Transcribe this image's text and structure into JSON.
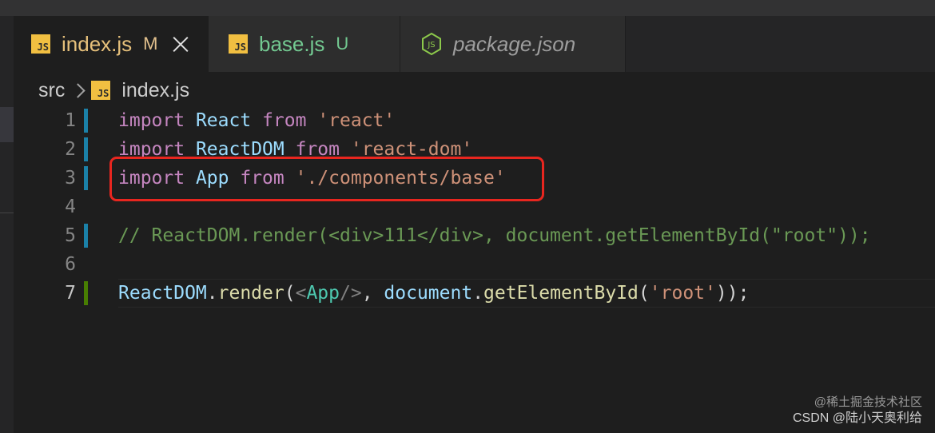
{
  "tabs": [
    {
      "label": "index.js",
      "status": "M",
      "icon": "js-file-icon",
      "active": true
    },
    {
      "label": "base.js",
      "status": "U",
      "icon": "js-file-icon",
      "active": false
    },
    {
      "label": "package.json",
      "status": "",
      "icon": "nodejs-icon",
      "active": false
    }
  ],
  "breadcrumb": {
    "folder": "src",
    "file": "index.js"
  },
  "editor": {
    "lines": [
      {
        "num": "1"
      },
      {
        "num": "2"
      },
      {
        "num": "3"
      },
      {
        "num": "4"
      },
      {
        "num": "5"
      },
      {
        "num": "6"
      },
      {
        "num": "7"
      }
    ],
    "tokens": {
      "l1": {
        "import": "import",
        "name": "React",
        "from": "from",
        "src": "'react'"
      },
      "l2": {
        "import": "import",
        "name": "ReactDOM",
        "from": "from",
        "src": "'react-dom'"
      },
      "l3": {
        "import": "import",
        "name": "App",
        "from": "from",
        "src": "'./components/base'"
      },
      "l5": {
        "comment": "// ReactDOM.render(<div>111</div>, document.getElementById(\"root\"));"
      },
      "l7": {
        "obj": "ReactDOM",
        "dot1": ".",
        "method": "render",
        "paren": "(",
        "lt": "<",
        "tag": "App",
        "selfclose": "/>",
        "comma": ", ",
        "doc": "document",
        "dot2": ".",
        "getter": "getElementById",
        "paren2": "(",
        "arg": "'root'",
        "close": "));"
      }
    }
  },
  "watermark": {
    "line1": "@稀土掘金技术社区",
    "line2": "CSDN @陆小天奥利给"
  },
  "colors": {
    "keyword": "#c586c0",
    "identifier": "#9cdcfe",
    "string": "#ce9178",
    "comment": "#6a9955",
    "function": "#dcdcaa",
    "tag": "#4ec9b0",
    "highlight_box": "#e8261f",
    "js_icon": "#f1bf41",
    "modified_bar": "#1b81a8",
    "added_bar": "#487e02"
  }
}
